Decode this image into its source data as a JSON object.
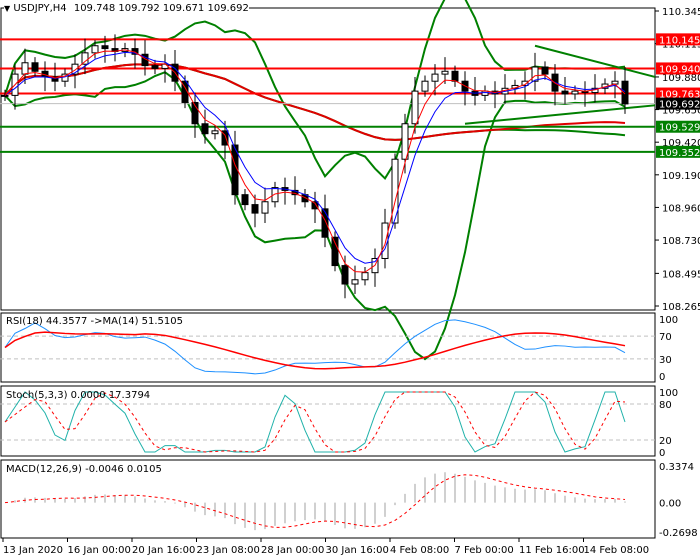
{
  "chart_data": {
    "type": "candlestick",
    "symbol_header": {
      "symbol": "USDJPY,H4",
      "open": "109.748",
      "high": "109.792",
      "low": "109.671",
      "close": "109.692"
    },
    "price_axis": {
      "ylim": [
        108.265,
        110.345
      ],
      "ticks": [
        "110.345",
        "110.115",
        "109.880",
        "109.650",
        "109.420",
        "109.190",
        "108.960",
        "108.730",
        "108.495",
        "108.265"
      ]
    },
    "time_axis": {
      "ticks": [
        "13 Jan 2020",
        "16 Jan 00:00",
        "20 Jan 16:00",
        "23 Jan 08:00",
        "28 Jan 00:00",
        "30 Jan 16:00",
        "4 Feb 08:00",
        "7 Feb 00:00",
        "11 Feb 16:00",
        "14 Feb 08:00"
      ]
    },
    "closes": [
      109.75,
      109.9,
      109.98,
      109.92,
      109.88,
      109.85,
      109.9,
      109.97,
      110.05,
      110.1,
      110.08,
      110.06,
      110.08,
      110.04,
      109.96,
      109.94,
      109.97,
      109.85,
      109.7,
      109.55,
      109.48,
      109.5,
      109.4,
      109.05,
      108.98,
      108.92,
      109.0,
      109.1,
      109.08,
      109.05,
      109.0,
      108.95,
      108.75,
      108.55,
      108.42,
      108.45,
      108.5,
      108.6,
      108.85,
      109.3,
      109.55,
      109.78,
      109.85,
      109.9,
      109.92,
      109.85,
      109.78,
      109.75,
      109.78,
      109.76,
      109.8,
      109.82,
      109.85,
      109.95,
      109.9,
      109.78,
      109.76,
      109.78,
      109.77,
      109.8,
      109.83,
      109.85,
      109.69
    ],
    "levels": [
      {
        "price": 110.145,
        "label": "110.145",
        "color": "#ff0000"
      },
      {
        "price": 109.94,
        "label": "109.940",
        "color": "#ff0000"
      },
      {
        "price": 109.763,
        "label": "109.763",
        "color": "#ff0000"
      },
      {
        "price": 109.529,
        "label": "109.529",
        "color": "#008000"
      },
      {
        "price": 109.352,
        "label": "109.352",
        "color": "#008000"
      }
    ],
    "current_price": {
      "price": 109.692,
      "label": "109.692"
    },
    "trendlines": [
      {
        "from": [
          46,
          109.55
        ],
        "to": [
          65,
          109.68
        ],
        "color": "#008000"
      },
      {
        "from": [
          53,
          110.1
        ],
        "to": [
          65,
          109.88
        ],
        "color": "#008000"
      }
    ],
    "rsi": {
      "label": "RSI(18) 44.3577  ->MA(14) 51.5105",
      "levels": [
        "100",
        "70",
        "30",
        "0"
      ]
    },
    "stoch": {
      "label": "Stoch(5,3,3) 0.0000 17.3794",
      "levels": [
        "100",
        "80",
        "20",
        "0"
      ]
    },
    "macd": {
      "label": "MACD(12,26,9) -0.0046 0.0105",
      "levels": [
        "0.3374",
        "0.00",
        "-0.2698"
      ],
      "range": [
        -0.2698,
        0.3374
      ]
    }
  }
}
